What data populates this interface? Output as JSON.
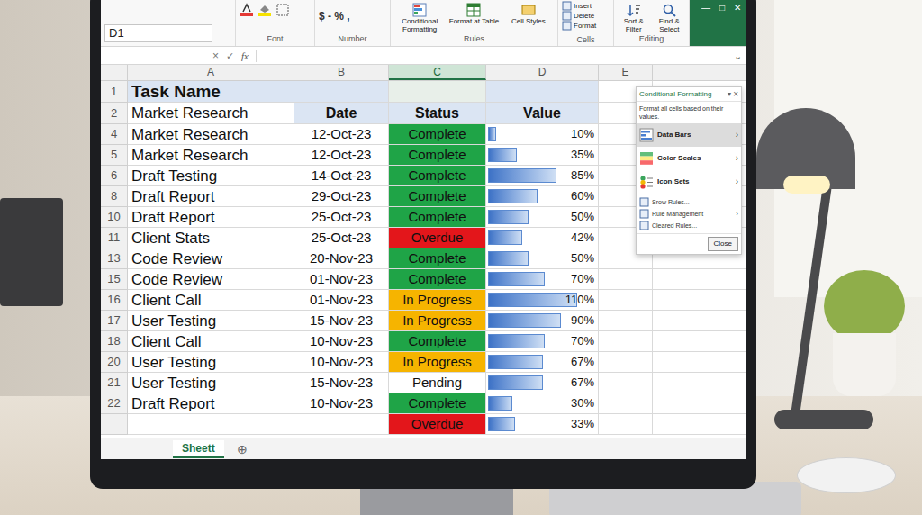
{
  "title_bar": {
    "controls": [
      "—",
      "□",
      "✕"
    ]
  },
  "ribbon": {
    "font_label": "Font",
    "number_format": "$ - % ,",
    "number_label": "Number",
    "styles_buttons": [
      "Conditional Formatting",
      "Format at Table",
      "Cell Styles"
    ],
    "styles_label": "Rules",
    "cells_buttons": [
      "Insert",
      "Delete",
      "Format"
    ],
    "cells_label": "Cells",
    "editing_buttons": [
      "Sort & Filter",
      "Find & Select"
    ],
    "editing_label": "Editing"
  },
  "formula_bar": {
    "name_box": "D1",
    "cancel": "×",
    "enter": "✓",
    "fx": "fx",
    "expand": "⌄"
  },
  "columns": [
    {
      "label": "A",
      "selected": false
    },
    {
      "label": "B",
      "selected": false
    },
    {
      "label": "C",
      "selected": true
    },
    {
      "label": "D",
      "selected": false
    },
    {
      "label": "E",
      "selected": false
    }
  ],
  "sheet": {
    "row1": {
      "num": "1",
      "text": "Task Name"
    },
    "row2": {
      "num": "2",
      "task": "Market Research",
      "headers": [
        "Date",
        "Status",
        "Value"
      ]
    },
    "rows": [
      {
        "num": "4",
        "task": "Market Research",
        "date": "12-Oct-23",
        "status": "Complete",
        "color": "#1fa447",
        "value": "10%",
        "level": 0.09
      },
      {
        "num": "5",
        "task": "Market Research",
        "date": "12-Oct-23",
        "status": "Complete",
        "color": "#1fa447",
        "value": "35%",
        "level": 0.32
      },
      {
        "num": "6",
        "task": "Draft Testing",
        "date": "14-Oct-23",
        "status": "Complete",
        "color": "#1fa447",
        "value": "85%",
        "level": 0.77
      },
      {
        "num": "8",
        "task": "Draft Report",
        "date": "29-Oct-23",
        "status": "Complete",
        "color": "#1fa447",
        "value": "60%",
        "level": 0.55
      },
      {
        "num": "10",
        "task": "Draft Report",
        "date": "25-Oct-23",
        "status": "Complete",
        "color": "#1fa447",
        "value": "50%",
        "level": 0.45
      },
      {
        "num": "11",
        "task": "Client Stats",
        "date": "25-Oct-23",
        "status": "Overdue",
        "color": "#e3161b",
        "value": "42%",
        "level": 0.38
      },
      {
        "num": "13",
        "task": "Code Review",
        "date": "20-Nov-23",
        "status": "Complete",
        "color": "#1fa447",
        "value": "50%",
        "level": 0.45
      },
      {
        "num": "15",
        "task": "Code Review",
        "date": "01-Nov-23",
        "status": "Complete",
        "color": "#1fa447",
        "value": "70%",
        "level": 0.64
      },
      {
        "num": "16",
        "task": "Client Call",
        "date": "01-Nov-23",
        "status": "In Progress",
        "color": "#f6b400",
        "value": "110%",
        "level": 1
      },
      {
        "num": "17",
        "task": "User Testing",
        "date": "15-Nov-23",
        "status": "In Progress",
        "color": "#f6b400",
        "value": "90%",
        "level": 0.82
      },
      {
        "num": "18",
        "task": "Client Call",
        "date": "10-Nov-23",
        "status": "Complete",
        "color": "#1fa447",
        "value": "70%",
        "level": 0.64
      },
      {
        "num": "20",
        "task": "User Testing",
        "date": "10-Nov-23",
        "status": "In Progress",
        "color": "#f6b400",
        "value": "67%",
        "level": 0.61
      },
      {
        "num": "21",
        "task": "User Testing",
        "date": "15-Nov-23",
        "status": "Pending",
        "color": "#ffffff",
        "value": "67%",
        "level": 0.61
      },
      {
        "num": "22",
        "task": "Draft Report",
        "date": "10-Nov-23",
        "status": "Complete",
        "color": "#1fa447",
        "value": "30%",
        "level": 0.27
      }
    ],
    "extra": {
      "status": "Overdue",
      "color": "#e3161b",
      "value": "33%",
      "level": 0.3
    }
  },
  "panel": {
    "title": "Conditional Formatting",
    "menu": "▾",
    "close_icon": "×",
    "subtitle": "Format all cells based on their values.",
    "options": [
      {
        "label": "Data Bars",
        "arrow": "›",
        "selected": true
      },
      {
        "label": "Color Scales",
        "arrow": "›",
        "selected": false
      },
      {
        "label": "Icon Sets",
        "arrow": "›",
        "selected": false
      }
    ],
    "links": [
      {
        "label": "Srow Rules...",
        "arrow": ""
      },
      {
        "label": "Rule Management",
        "arrow": "›"
      },
      {
        "label": "Cleared Rules...",
        "arrow": ""
      }
    ],
    "button": "Close"
  },
  "sheet_tabs": {
    "tabs": [
      {
        "label": "Sheett",
        "selected": true
      }
    ],
    "add": "⊕"
  }
}
